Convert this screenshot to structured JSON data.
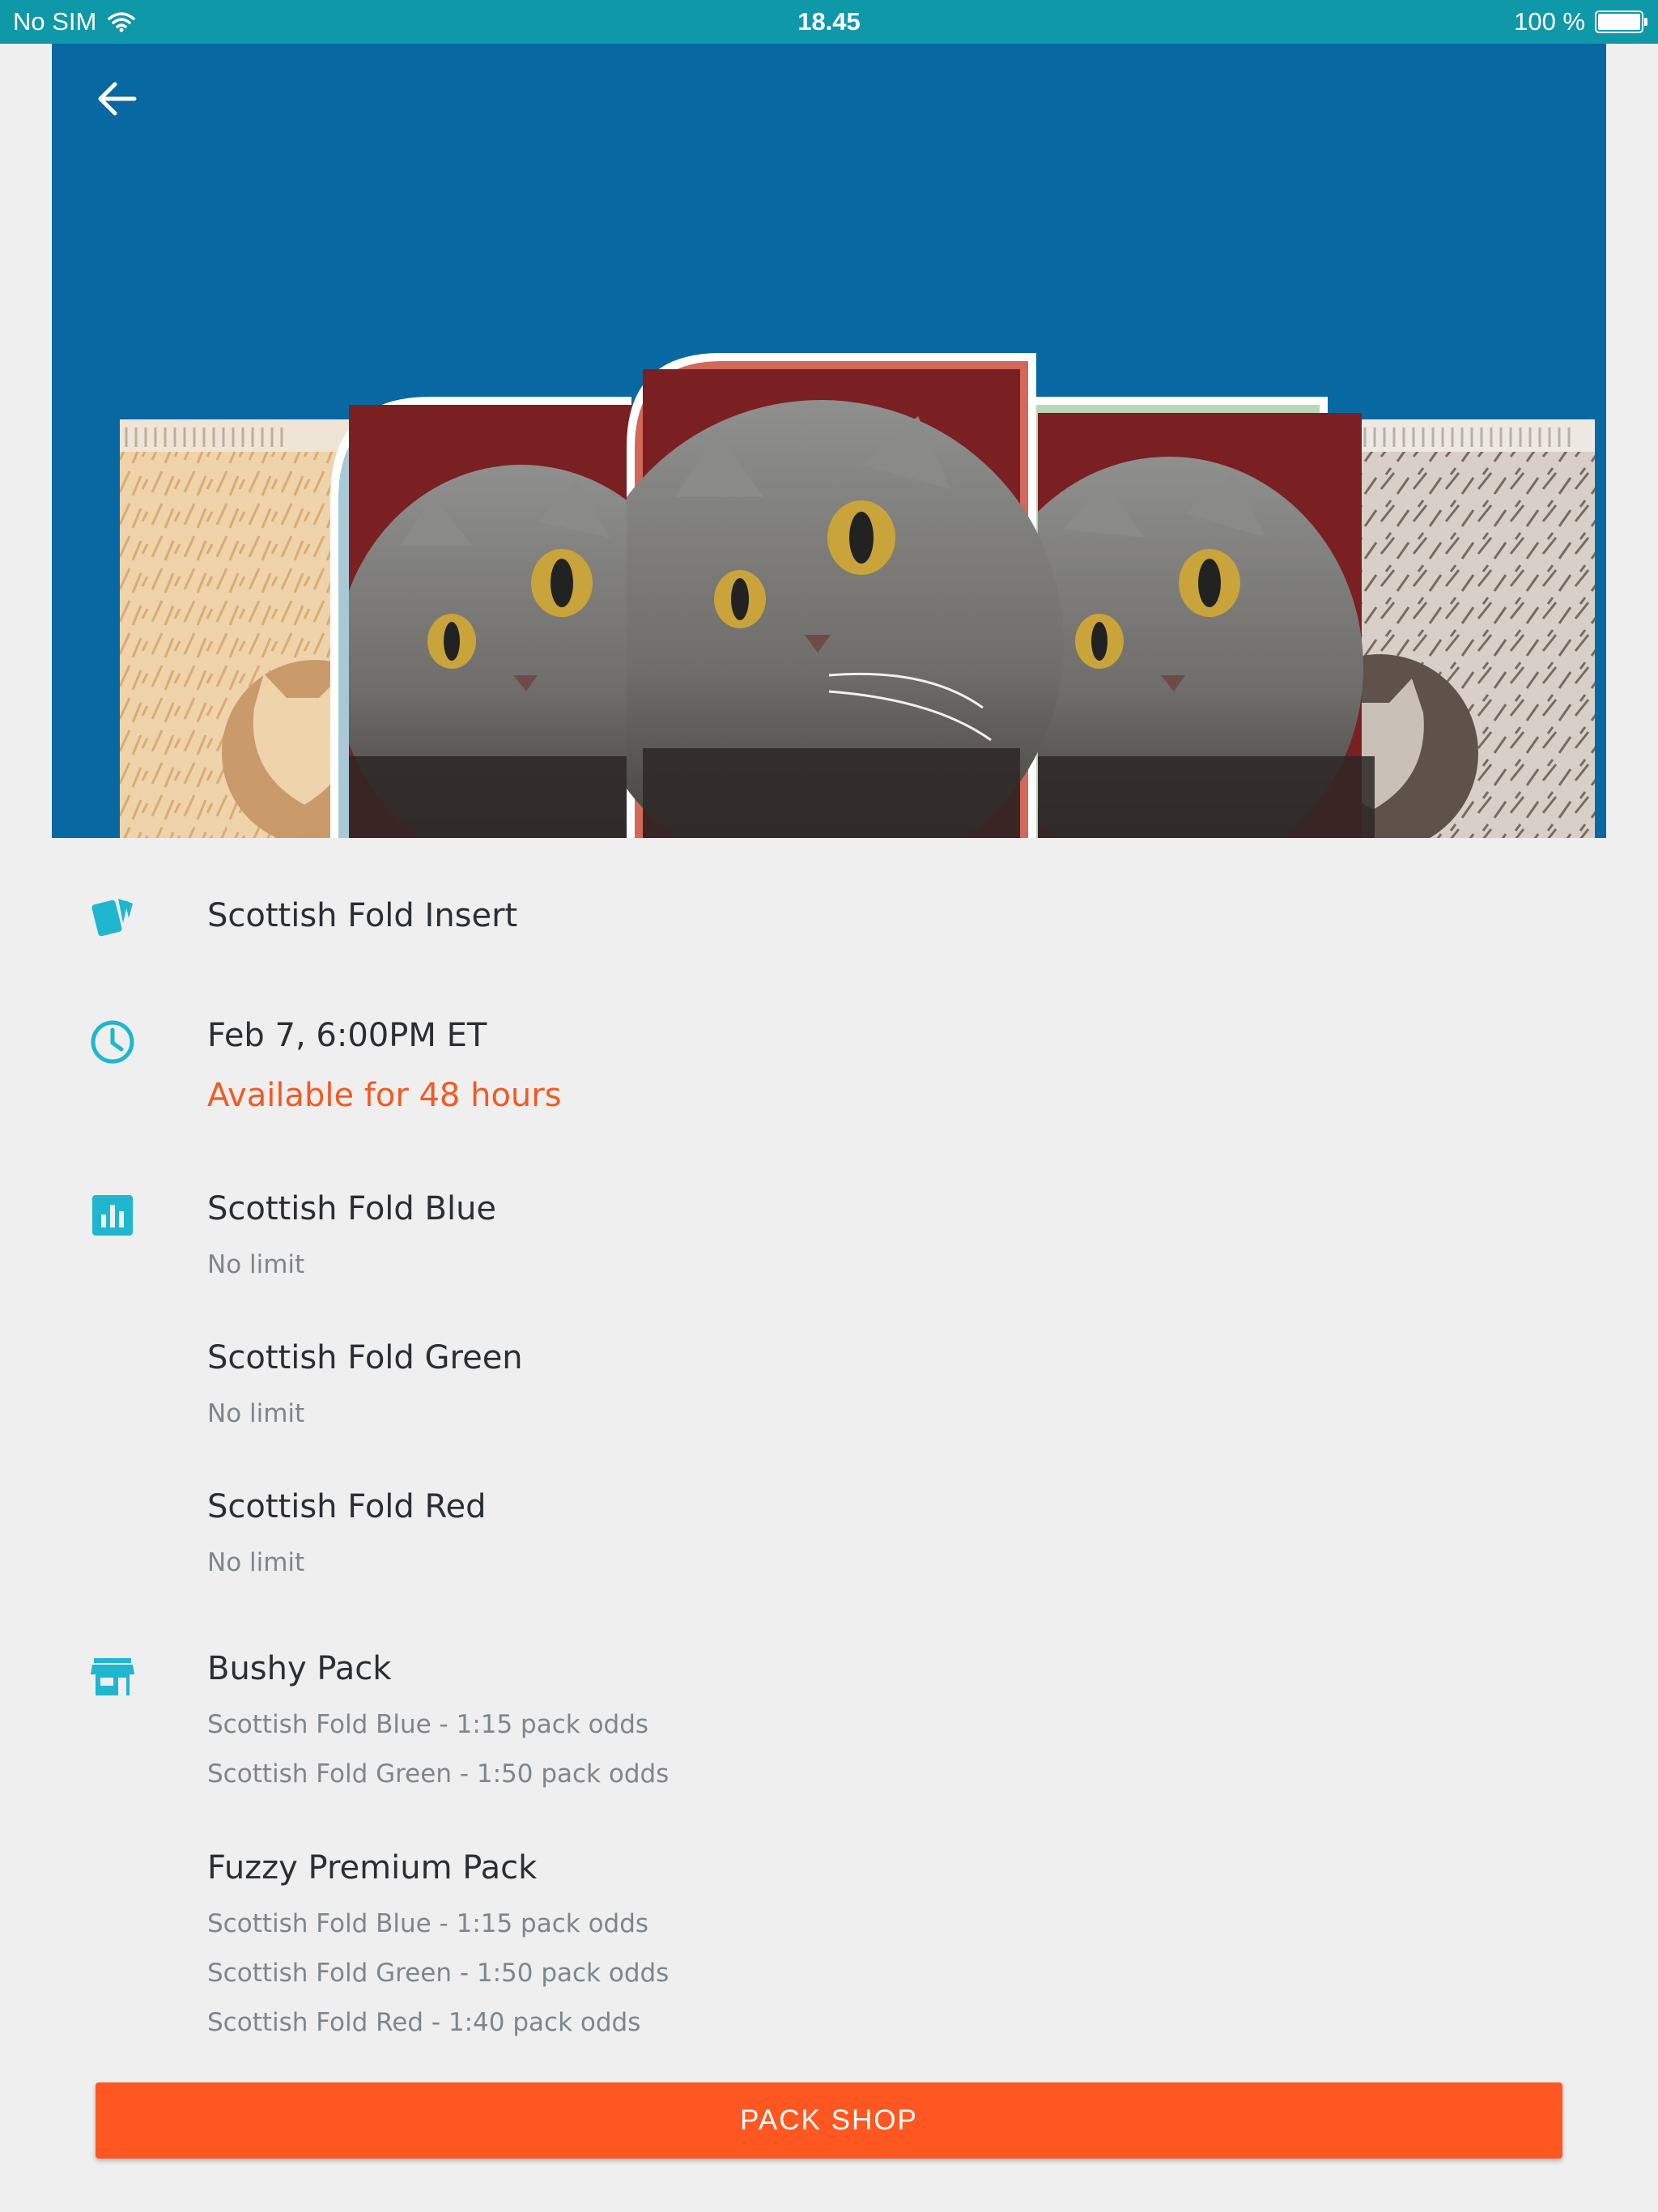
{
  "status_bar": {
    "carrier": "No SIM",
    "time": "18.45",
    "battery_text": "100 %"
  },
  "hero": {
    "back_icon": "arrow-left-icon"
  },
  "colors": {
    "status_bar": "#0f98a8",
    "hero_bg": "#0868a2",
    "accent": "#1fb6cf",
    "warning": "#f15a24",
    "button": "#ff5722"
  },
  "set": {
    "icon": "cards-icon",
    "name": "Scottish Fold Insert"
  },
  "release": {
    "icon": "clock-icon",
    "date": "Feb 7, 6:00PM ET",
    "availability": "Available for 48 hours"
  },
  "variants": {
    "icon": "bar-chart-icon",
    "items": [
      {
        "name": "Scottish Fold Blue",
        "limit": "No limit"
      },
      {
        "name": "Scottish Fold Green",
        "limit": "No limit"
      },
      {
        "name": "Scottish Fold Red",
        "limit": "No limit"
      }
    ]
  },
  "packs": {
    "icon": "store-icon",
    "items": [
      {
        "name": "Bushy Pack",
        "odds": [
          "Scottish Fold Blue - 1:15 pack odds",
          "Scottish Fold Green - 1:50 pack odds"
        ]
      },
      {
        "name": "Fuzzy Premium Pack",
        "odds": [
          "Scottish Fold Blue - 1:15 pack odds",
          "Scottish Fold Green - 1:50 pack odds",
          "Scottish Fold Red - 1:40 pack odds"
        ]
      }
    ]
  },
  "button": {
    "label": "PACK SHOP"
  }
}
